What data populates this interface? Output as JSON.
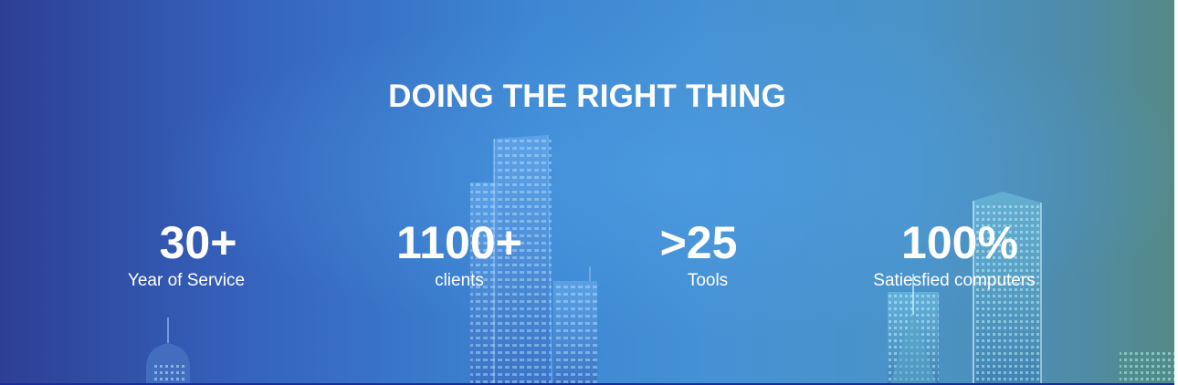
{
  "section": {
    "title": "DOING THE RIGHT THING"
  },
  "stats": [
    {
      "value": "30+",
      "label": "Year of Service"
    },
    {
      "value": "1100+",
      "label": "clients"
    },
    {
      "value": ">25",
      "label": "Tools"
    },
    {
      "value": "100%",
      "label": "Satiesfied computers"
    }
  ],
  "colors": {
    "gradient_left": "#2d3f94",
    "gradient_mid": "#3c86d3",
    "gradient_right": "#548a86",
    "text": "#ffffff",
    "bottom_line": "#1b2a9c"
  }
}
